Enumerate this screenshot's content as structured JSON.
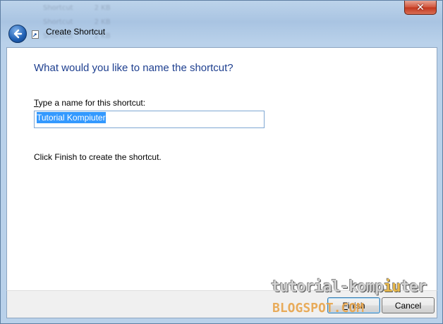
{
  "window": {
    "title": "Create Shortcut",
    "close_label": "✕"
  },
  "dialog": {
    "heading": "What would you like to name the shortcut?",
    "field_label_first": "T",
    "field_label_rest": "ype a name for this shortcut:",
    "name_value": "Tutorial Kompiuter",
    "hint": "Click Finish to create the shortcut."
  },
  "buttons": {
    "finish_first": "F",
    "finish_rest": "inish",
    "cancel": "Cancel"
  },
  "watermark": {
    "line1_a": "tutorial-komp",
    "line1_hl": "iu",
    "line1_b": "ter",
    "line2": "BLOGSPOT.COM"
  },
  "background_rows": [
    [
      "Shortcut",
      "2 KB"
    ],
    [
      "Shortcut",
      "2 KB"
    ],
    [
      "Shortcut",
      "2 KB"
    ]
  ]
}
